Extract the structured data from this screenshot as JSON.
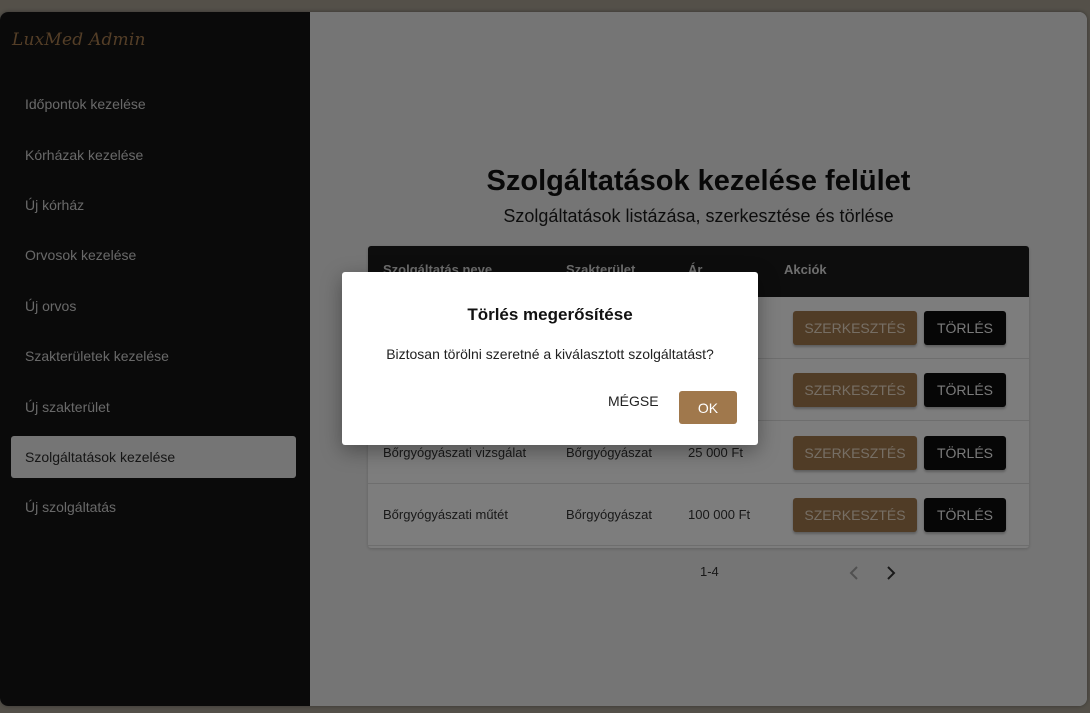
{
  "sidebar": {
    "brand": "LuxMed Admin",
    "items": [
      {
        "label": "Időpontok kezelése"
      },
      {
        "label": "Kórházak kezelése"
      },
      {
        "label": "Új kórház"
      },
      {
        "label": "Orvosok kezelése"
      },
      {
        "label": "Új orvos"
      },
      {
        "label": "Szakterületek kezelése"
      },
      {
        "label": "Új szakterület"
      },
      {
        "label": "Szolgáltatások kezelése",
        "active": true
      },
      {
        "label": "Új szolgáltatás"
      }
    ]
  },
  "main": {
    "title": "Szolgáltatások kezelése felület",
    "subtitle": "Szolgáltatások listázása, szerkesztése és törlése"
  },
  "table": {
    "columns": [
      "Szolgáltatás neve",
      "Szakterület",
      "Ár",
      "Akciók"
    ],
    "rows": [
      {
        "name": "",
        "specialty": "",
        "price": ""
      },
      {
        "name": "",
        "specialty": "",
        "price": ""
      },
      {
        "name": "Bőrgyógyászati vizsgálat",
        "specialty": "Bőrgyógyászat",
        "price": "25 000 Ft"
      },
      {
        "name": "Bőrgyógyászati műtét",
        "specialty": "Bőrgyógyászat",
        "price": "100 000 Ft"
      }
    ],
    "edit_label": "SZERKESZTÉS",
    "delete_label": "TÖRLÉS"
  },
  "pagination": {
    "range": "1-4",
    "prev_icon": "chevron-left-icon",
    "next_icon": "chevron-right-icon"
  },
  "dialog": {
    "title": "Törlés megerősítése",
    "message": "Biztosan törölni szeretné a kiválasztott szolgáltatást?",
    "cancel_label": "MÉGSE",
    "ok_label": "OK"
  },
  "colors": {
    "accent": "#a0784c",
    "brand": "#a87d4e",
    "sidebar_bg": "#151515",
    "overlay": "rgba(0,0,0,0.5)"
  }
}
